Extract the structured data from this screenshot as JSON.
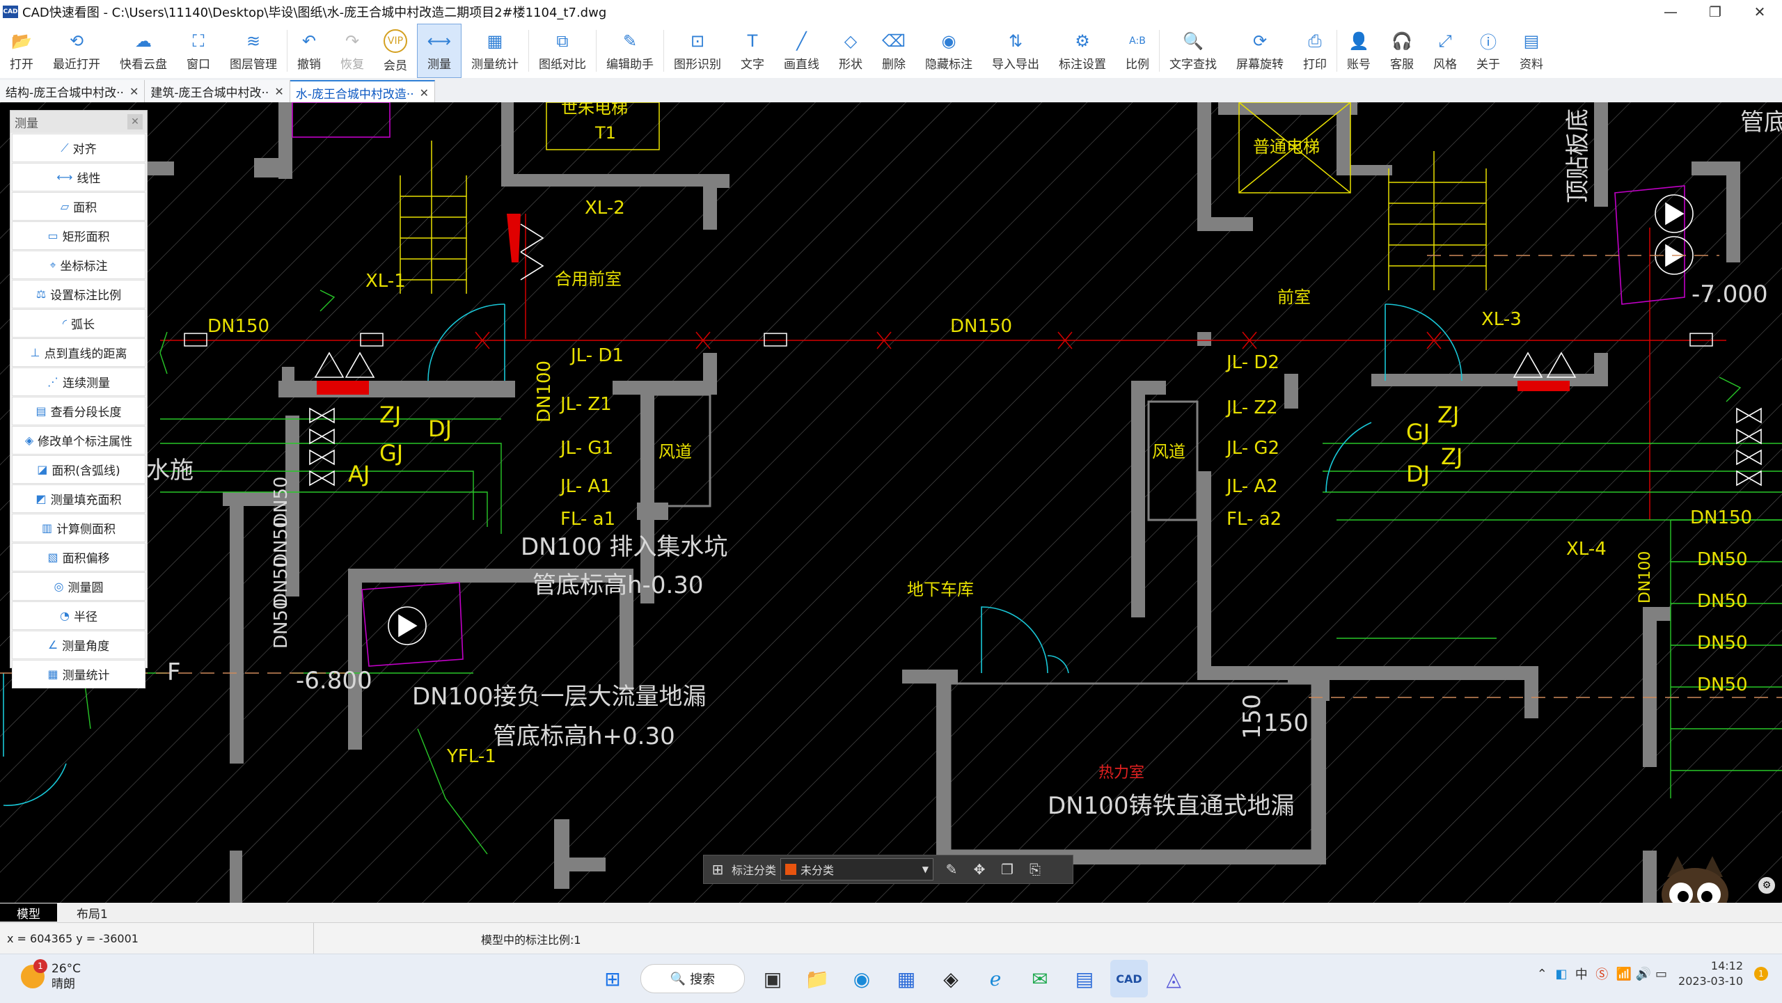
{
  "window": {
    "logo": "CAD",
    "title": "CAD快速看图 - C:\\Users\\11140\\Desktop\\毕设\\图纸\\水-庞王合城中村改造二期项目2#楼1104_t7.dwg",
    "controls": [
      "—",
      "❐",
      "✕"
    ]
  },
  "toolbar": [
    {
      "label": "打开",
      "icon": "folder-open-icon",
      "glyph": "📂"
    },
    {
      "label": "最近打开",
      "icon": "history-icon",
      "glyph": "⟲"
    },
    {
      "label": "快看云盘",
      "icon": "cloud-icon",
      "glyph": "☁"
    },
    {
      "label": "窗口",
      "icon": "window-icon",
      "glyph": "⛶"
    },
    {
      "label": "图层管理",
      "icon": "layers-icon",
      "glyph": "≋"
    },
    {
      "label": "撤销",
      "icon": "undo-icon",
      "glyph": "↶"
    },
    {
      "label": "恢复",
      "icon": "redo-icon",
      "glyph": "↷"
    },
    {
      "label": "会员",
      "icon": "vip-icon",
      "glyph": "VIP"
    },
    {
      "label": "测量",
      "icon": "ruler-icon",
      "glyph": "⟷"
    },
    {
      "label": "测量统计",
      "icon": "measure-stats-icon",
      "glyph": "▦"
    },
    {
      "label": "图纸对比",
      "icon": "compare-icon",
      "glyph": "⧉"
    },
    {
      "label": "编辑助手",
      "icon": "edit-assistant-icon",
      "glyph": "✎"
    },
    {
      "label": "图形识别",
      "icon": "shape-recognition-icon",
      "glyph": "⊡"
    },
    {
      "label": "文字",
      "icon": "text-icon",
      "glyph": "T"
    },
    {
      "label": "画直线",
      "icon": "line-icon",
      "glyph": "╱"
    },
    {
      "label": "形状",
      "icon": "shape-icon",
      "glyph": "◇"
    },
    {
      "label": "删除",
      "icon": "eraser-icon",
      "glyph": "⌫"
    },
    {
      "label": "隐藏标注",
      "icon": "hide-icon",
      "glyph": "◉"
    },
    {
      "label": "导入导出",
      "icon": "import-export-icon",
      "glyph": "⇅"
    },
    {
      "label": "标注设置",
      "icon": "annotation-settings-icon",
      "glyph": "⚙"
    },
    {
      "label": "比例",
      "icon": "scale-icon",
      "glyph": "A:B"
    },
    {
      "label": "文字查找",
      "icon": "text-search-icon",
      "glyph": "🔍"
    },
    {
      "label": "屏幕旋转",
      "icon": "rotate-icon",
      "glyph": "⟳"
    },
    {
      "label": "打印",
      "icon": "print-icon",
      "glyph": "⎙"
    },
    {
      "label": "账号",
      "icon": "account-icon",
      "glyph": "👤"
    },
    {
      "label": "客服",
      "icon": "headset-icon",
      "glyph": "🎧"
    },
    {
      "label": "风格",
      "icon": "style-icon",
      "glyph": "⤢"
    },
    {
      "label": "关于",
      "icon": "info-icon",
      "glyph": "ⓘ"
    },
    {
      "label": "资料",
      "icon": "docs-icon",
      "glyph": "▤"
    }
  ],
  "tabs": [
    {
      "label": "结构-庞王合城中村改··",
      "active": false
    },
    {
      "label": "建筑-庞王合城中村改··",
      "active": false
    },
    {
      "label": "水-庞王合城中村改造··",
      "active": true
    }
  ],
  "measure_panel": {
    "title": "测量",
    "items": [
      {
        "label": "对齐",
        "glyph": "⟋"
      },
      {
        "label": "线性",
        "glyph": "⟷"
      },
      {
        "label": "面积",
        "glyph": "▱"
      },
      {
        "label": "矩形面积",
        "glyph": "▭"
      },
      {
        "label": "坐标标注",
        "glyph": "⌖"
      },
      {
        "label": "设置标注比例",
        "glyph": "⚖"
      },
      {
        "label": "弧长",
        "glyph": "◜"
      },
      {
        "label": "点到直线的距离",
        "glyph": "⊥"
      },
      {
        "label": "连续测量",
        "glyph": "⋰"
      },
      {
        "label": "查看分段长度",
        "glyph": "▤"
      },
      {
        "label": "修改单个标注属性",
        "glyph": "◈"
      },
      {
        "label": "面积(含弧线)",
        "glyph": "◪"
      },
      {
        "label": "测量填充面积",
        "glyph": "◩"
      },
      {
        "label": "计算侧面积",
        "glyph": "▥"
      },
      {
        "label": "面积偏移",
        "glyph": "▧"
      },
      {
        "label": "测量圆",
        "glyph": "◎"
      },
      {
        "label": "半径",
        "glyph": "◔"
      },
      {
        "label": "测量角度",
        "glyph": "∠"
      },
      {
        "label": "测量统计",
        "glyph": "▦"
      }
    ]
  },
  "drawing": {
    "labels_yellow": [
      "XL-2",
      "XL-1",
      "XL-3",
      "XL-4",
      "DN150",
      "DN150",
      "JL- D1",
      "JL- Z1",
      "JL- G1",
      "JL- A1",
      "FL- a1",
      "JL- D2",
      "JL- Z2",
      "JL- G2",
      "JL- A2",
      "FL- a2",
      "ZJ",
      "GJ",
      "AJ",
      "DJ",
      "DN100",
      "DN100",
      "DN150",
      "DN50",
      "DN50",
      "DN50",
      "DN50",
      "YFL-1"
    ],
    "labels_large_white": [
      "DN100 排入集水坑",
      "管底标高h-0.30",
      "DN100接负一层大流量地漏",
      "管底标高h+0.30",
      "DN100铸铁直通式地漏",
      "-6.800",
      "-7.000",
      "150",
      "150",
      "F",
      "管底",
      "顶贴板底",
      "DN50",
      "DN50",
      "DN50",
      "DN50"
    ],
    "labels_yellow_zh": [
      "合用前室",
      "前室",
      "风道",
      "风道",
      "普通电梯",
      "地下车库",
      "水施",
      "世朱电梯",
      "T1"
    ],
    "label_red": "热力室"
  },
  "float_bar": {
    "category_label": "标注分类",
    "selected": "未分类",
    "swatch_color": "#e8540f"
  },
  "layout_tabs": [
    {
      "label": "模型",
      "active": true
    },
    {
      "label": "布局1",
      "active": false
    }
  ],
  "status": {
    "coords": "x = 604365  y = -36001",
    "scale_text": "模型中的标注比例:1"
  },
  "taskbar": {
    "weather_temp": "26°C",
    "weather_desc": "晴朗",
    "weather_badge": "1",
    "search_label": "搜索",
    "time": "14:12",
    "date": "2023-03-10",
    "ime": "中",
    "notif_count": "1"
  }
}
